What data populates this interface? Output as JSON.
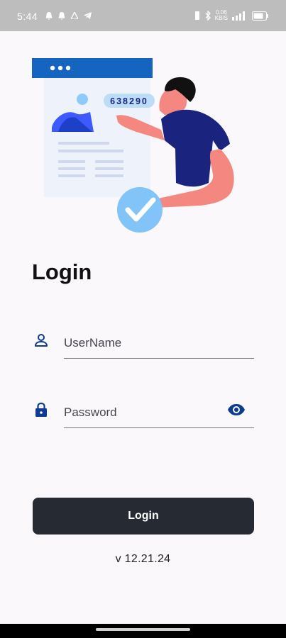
{
  "status_bar": {
    "time": "5:44",
    "network_rate": "0.06",
    "network_unit": "KB/S",
    "icons": [
      "notification-icon",
      "notification-icon",
      "warning-icon",
      "telegram-icon",
      "vibrate-icon",
      "bluetooth-icon",
      "signal-icon",
      "battery-icon"
    ]
  },
  "illustration": {
    "otp_code": "638290",
    "colors": {
      "banner": "#1565c0",
      "shirt": "#1a237e",
      "skin": "#f4877f",
      "check": "#64b5f6"
    }
  },
  "login_title": "Login",
  "username": {
    "placeholder": "UserName",
    "value": "",
    "icon": "person-icon"
  },
  "password": {
    "placeholder": "Password",
    "value": "",
    "icon": "lock-icon",
    "toggle_icon": "eye-icon"
  },
  "login_button_label": "Login",
  "version": "v 12.21.24",
  "colors": {
    "accent": "#0d3b8f",
    "button": "#252a33",
    "background": "#fbf8fc"
  }
}
